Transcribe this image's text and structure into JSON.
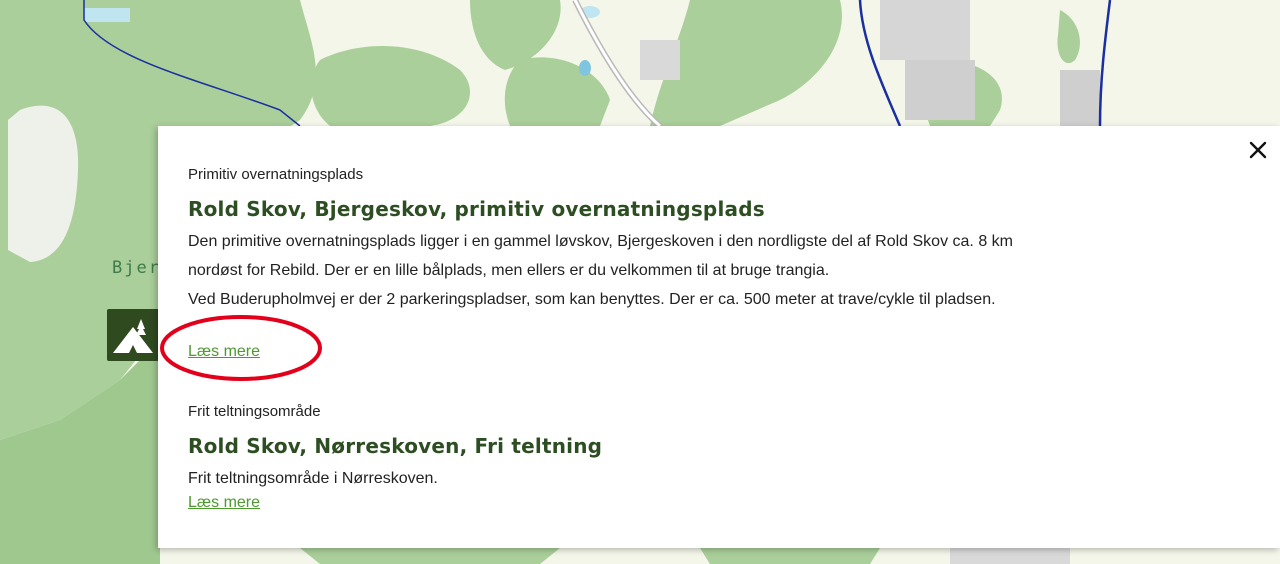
{
  "map": {
    "place_label": "Bjer",
    "colors": {
      "forest": "#aacf9a",
      "forest_dark": "#8fbf7e",
      "open_land": "#f4f6ea",
      "water": "#bfe6f0",
      "road_blue": "#1a2fa0",
      "built_area": "#cfcfcf"
    },
    "marker_icon": "tent-icon"
  },
  "popup": {
    "close_icon": "close-icon",
    "entries": [
      {
        "category": "Primitiv overnatningsplads",
        "title": "Rold Skov, Bjergeskov, primitiv overnatningsplads",
        "description_lines": [
          "Den primitive overnatningsplads ligger i en gammel løvskov, Bjergeskoven i den nordligste del af Rold Skov ca. 8 km",
          "nordøst for Rebild. Der er en lille bålplads, men ellers er du velkommen til at bruge trangia.",
          "Ved Buderupholmvej er der 2 parkeringspladser, som kan benyttes. Der er ca. 500 meter at trave/cykle til pladsen."
        ],
        "link_label": "Læs mere"
      },
      {
        "category": "Frit teltningsområde",
        "title": "Rold Skov, Nørreskoven, Fri teltning",
        "description_lines": [
          "Frit teltningsområde i Nørreskoven."
        ],
        "link_label": "Læs mere"
      }
    ],
    "colors": {
      "title": "#2d4d22",
      "link": "#4d9a2f",
      "highlight": "#e3001b"
    }
  }
}
